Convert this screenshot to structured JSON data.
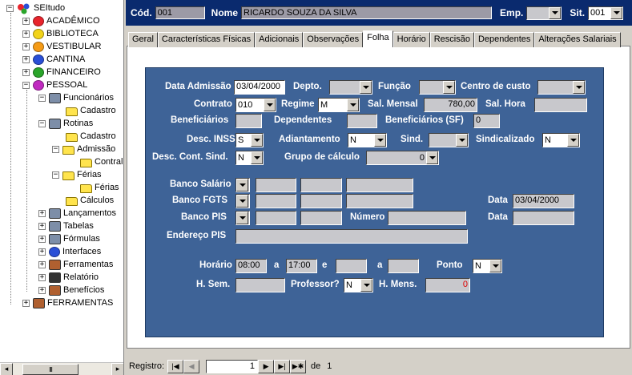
{
  "tree": {
    "root": "SEItudo",
    "items": [
      {
        "label": "ACADÊMICO",
        "color": "#e8242c"
      },
      {
        "label": "BIBLIOTECA",
        "color": "#f2d31a"
      },
      {
        "label": "VESTIBULAR",
        "color": "#f59b16"
      },
      {
        "label": "CANTINA",
        "color": "#2a4fd6"
      },
      {
        "label": "FINANCEIRO",
        "color": "#2aa52a"
      },
      {
        "label": "PESSOAL",
        "color": "#c02ac0"
      }
    ],
    "pessoal_children": {
      "funcionarios": "Funcionários",
      "cadastro1": "Cadastro",
      "rotinas": "Rotinas",
      "cadastro2": "Cadastro",
      "admissao": "Admissão",
      "contral": "Contral",
      "ferias": "Férias",
      "ferias2": "Férias",
      "calculos": "Cálculos",
      "lancamentos": "Lançamentos",
      "tabelas": "Tabelas",
      "formulas": "Fórmulas",
      "interfaces": "Interfaces",
      "ferramentas": "Ferramentas",
      "relatorio": "Relatório",
      "beneficios": "Benefícios"
    },
    "ferramentas_root": "FERRAMENTAS",
    "scroll_thumb": "III"
  },
  "header": {
    "cod_label": "Cód.",
    "cod_value": "001",
    "nome_label": "Nome",
    "nome_value": "RICARDO SOUZA DA SILVA",
    "emp_label": "Emp.",
    "emp_value": "",
    "sit_label": "Sit.",
    "sit_value": "001"
  },
  "tabs": [
    {
      "label": "Geral"
    },
    {
      "label": "Características Físicas"
    },
    {
      "label": "Adicionais"
    },
    {
      "label": "Observações"
    },
    {
      "label": "Folha"
    },
    {
      "label": "Horário"
    },
    {
      "label": "Rescisão"
    },
    {
      "label": "Dependentes"
    },
    {
      "label": "Alterações Salariais"
    }
  ],
  "form": {
    "data_admissao_label": "Data Admissão",
    "data_admissao": "03/04/2000",
    "depto_label": "Depto.",
    "funcao_label": "Função",
    "centro_label": "Centro de custo",
    "contrato_label": "Contrato",
    "contrato": "010",
    "regime_label": "Regime",
    "regime": "M",
    "sal_mensal_label": "Sal. Mensal",
    "sal_mensal": "780,00",
    "sal_hora_label": "Sal. Hora",
    "beneficiarios_label": "Beneficiários",
    "dependentes_label": "Dependentes",
    "benef_sf_label": "Beneficiários (SF)",
    "benef_sf": "0",
    "desc_inss_label": "Desc. INSS",
    "desc_inss": "S",
    "adiantamento_label": "Adiantamento",
    "adiantamento": "N",
    "sind_label": "Sind.",
    "sindicalizado_label": "Sindicalizado",
    "sindicalizado": "N",
    "desc_cont_sind_label": "Desc. Cont. Sind.",
    "desc_cont_sind": "N",
    "grupo_calc_label": "Grupo de cálculo",
    "grupo_calc": "0",
    "banco_salario_label": "Banco Salário",
    "banco_fgts_label": "Banco FGTS",
    "data_label": "Data",
    "data_fgts": "03/04/2000",
    "banco_pis_label": "Banco PIS",
    "numero_label": "Número",
    "data2_label": "Data",
    "endereco_pis_label": "Endereço PIS",
    "horario_label": "Horário",
    "horario_ini": "08:00",
    "a_label": "a",
    "horario_fim": "17:00",
    "e_label": "e",
    "a2_label": "a",
    "ponto_label": "Ponto",
    "ponto": "N",
    "hsem_label": "H. Sem.",
    "professor_label": "Professor?",
    "professor": "N",
    "hmens_label": "H. Mens.",
    "hmens": "0"
  },
  "status": {
    "registro_label": "Registro:",
    "registro_value": "1",
    "de_label": "de",
    "total": "1"
  },
  "colors": {
    "header_bg": "#0a2a6e",
    "panel_bg": "#3e6397",
    "hmens_text": "#e00000"
  }
}
